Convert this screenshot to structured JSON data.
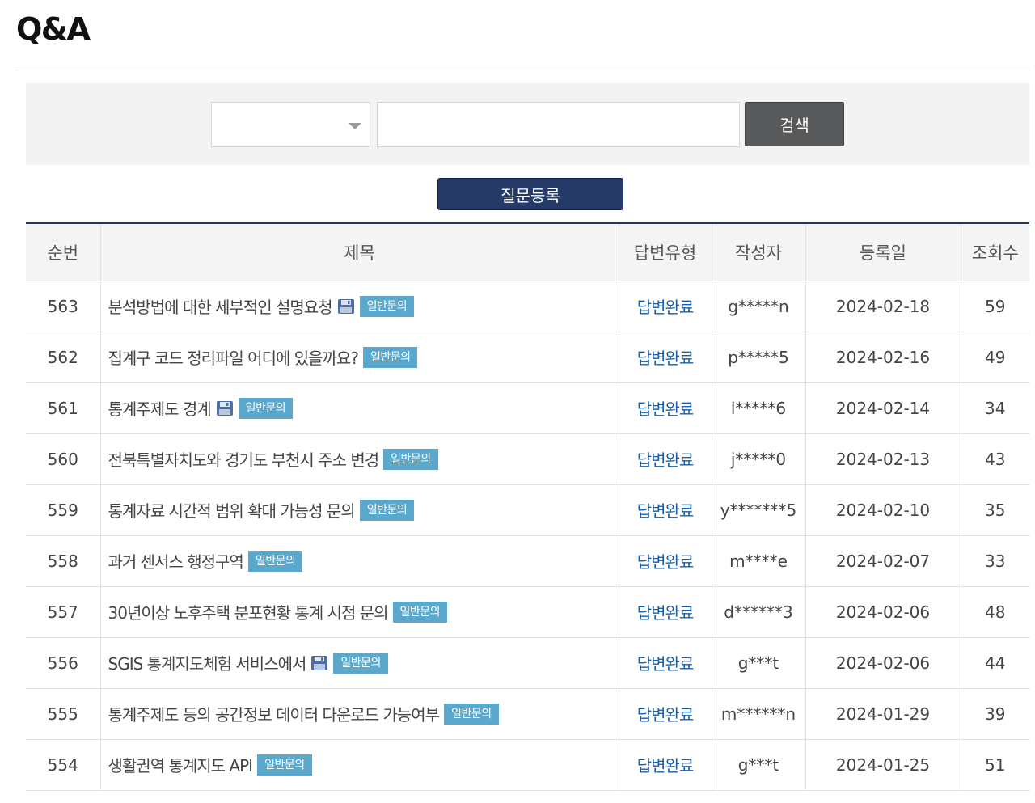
{
  "page": {
    "title": "Q&A"
  },
  "search": {
    "select_value": "",
    "input_value": "",
    "input_placeholder": "",
    "button_label": "검색"
  },
  "actions": {
    "register_label": "질문등록"
  },
  "table": {
    "headers": {
      "no": "순번",
      "title": "제목",
      "answer_type": "답변유형",
      "author": "작성자",
      "date": "등록일",
      "views": "조회수"
    },
    "rows": [
      {
        "no": "563",
        "title": "분석방법에 대한 세부적인 설명요청",
        "attachment": true,
        "category": "일반문의",
        "status": "답변완료",
        "author": "g*****n",
        "date": "2024-02-18",
        "views": "59"
      },
      {
        "no": "562",
        "title": "집계구 코드 정리파일 어디에 있을까요?",
        "attachment": false,
        "category": "일반문의",
        "status": "답변완료",
        "author": "p*****5",
        "date": "2024-02-16",
        "views": "49"
      },
      {
        "no": "561",
        "title": "통계주제도 경계",
        "attachment": true,
        "category": "일반문의",
        "status": "답변완료",
        "author": "l*****6",
        "date": "2024-02-14",
        "views": "34"
      },
      {
        "no": "560",
        "title": "전북특별자치도와 경기도 부천시 주소 변경",
        "attachment": false,
        "category": "일반문의",
        "status": "답변완료",
        "author": "j*****0",
        "date": "2024-02-13",
        "views": "43"
      },
      {
        "no": "559",
        "title": "통계자료 시간적 범위 확대 가능성 문의",
        "attachment": false,
        "category": "일반문의",
        "status": "답변완료",
        "author": "y*******5",
        "date": "2024-02-10",
        "views": "35"
      },
      {
        "no": "558",
        "title": "과거 센서스 행정구역",
        "attachment": false,
        "category": "일반문의",
        "status": "답변완료",
        "author": "m****e",
        "date": "2024-02-07",
        "views": "33"
      },
      {
        "no": "557",
        "title": "30년이상 노후주택 분포현황 통계 시점 문의",
        "attachment": false,
        "category": "일반문의",
        "status": "답변완료",
        "author": "d******3",
        "date": "2024-02-06",
        "views": "48"
      },
      {
        "no": "556",
        "title": "SGIS 통계지도체험 서비스에서",
        "attachment": true,
        "category": "일반문의",
        "status": "답변완료",
        "author": "g***t",
        "date": "2024-02-06",
        "views": "44"
      },
      {
        "no": "555",
        "title": "통계주제도 등의 공간정보 데이터 다운로드 가능여부",
        "attachment": false,
        "category": "일반문의",
        "status": "답변완료",
        "author": "m******n",
        "date": "2024-01-29",
        "views": "39"
      },
      {
        "no": "554",
        "title": "생활권역 통계지도 API",
        "attachment": false,
        "category": "일반문의",
        "status": "답변완료",
        "author": "g***t",
        "date": "2024-01-25",
        "views": "51"
      }
    ]
  },
  "icons": {
    "attachment": "floppy-disk-icon",
    "select_caret": "caret-down-icon"
  },
  "colors": {
    "header_navy": "#253a66",
    "badge_blue": "#5aa9cc",
    "link_blue": "#1b5fa8",
    "search_button": "#58595b"
  }
}
